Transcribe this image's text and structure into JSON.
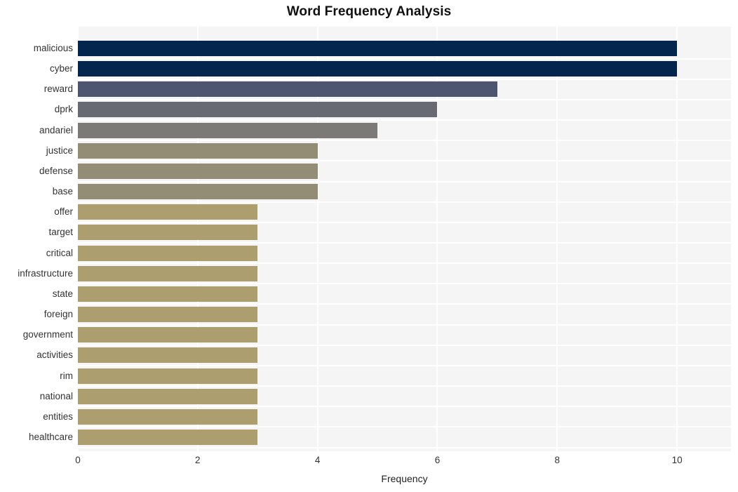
{
  "chart_data": {
    "type": "bar",
    "orientation": "horizontal",
    "title": "Word Frequency Analysis",
    "xlabel": "Frequency",
    "ylabel": "",
    "categories": [
      "malicious",
      "cyber",
      "reward",
      "dprk",
      "andariel",
      "justice",
      "defense",
      "base",
      "offer",
      "target",
      "critical",
      "infrastructure",
      "state",
      "foreign",
      "government",
      "activities",
      "rim",
      "national",
      "entities",
      "healthcare"
    ],
    "values": [
      10,
      10,
      7,
      6,
      5,
      4,
      4,
      4,
      3,
      3,
      3,
      3,
      3,
      3,
      3,
      3,
      3,
      3,
      3,
      3
    ],
    "bar_colors": [
      "#04254e",
      "#04254e",
      "#4d5570",
      "#686a73",
      "#7b7a77",
      "#948d76",
      "#948d76",
      "#948d76",
      "#ac9e6e",
      "#ac9e6e",
      "#ac9e6e",
      "#ac9e6e",
      "#ac9e6e",
      "#ac9e6e",
      "#ac9e6e",
      "#ac9e6e",
      "#ac9e6e",
      "#ac9e6e",
      "#ac9e6e",
      "#ac9e6e"
    ],
    "xlim": [
      0,
      10.9
    ],
    "xticks": [
      0,
      2,
      4,
      6,
      8,
      10
    ],
    "xtick_labels": [
      "0",
      "2",
      "4",
      "6",
      "8",
      "10"
    ],
    "grid": true,
    "grid_color": "#ffffff",
    "plot_background": "#f5f5f6",
    "figure_background": "#ffffff",
    "legend": null
  }
}
